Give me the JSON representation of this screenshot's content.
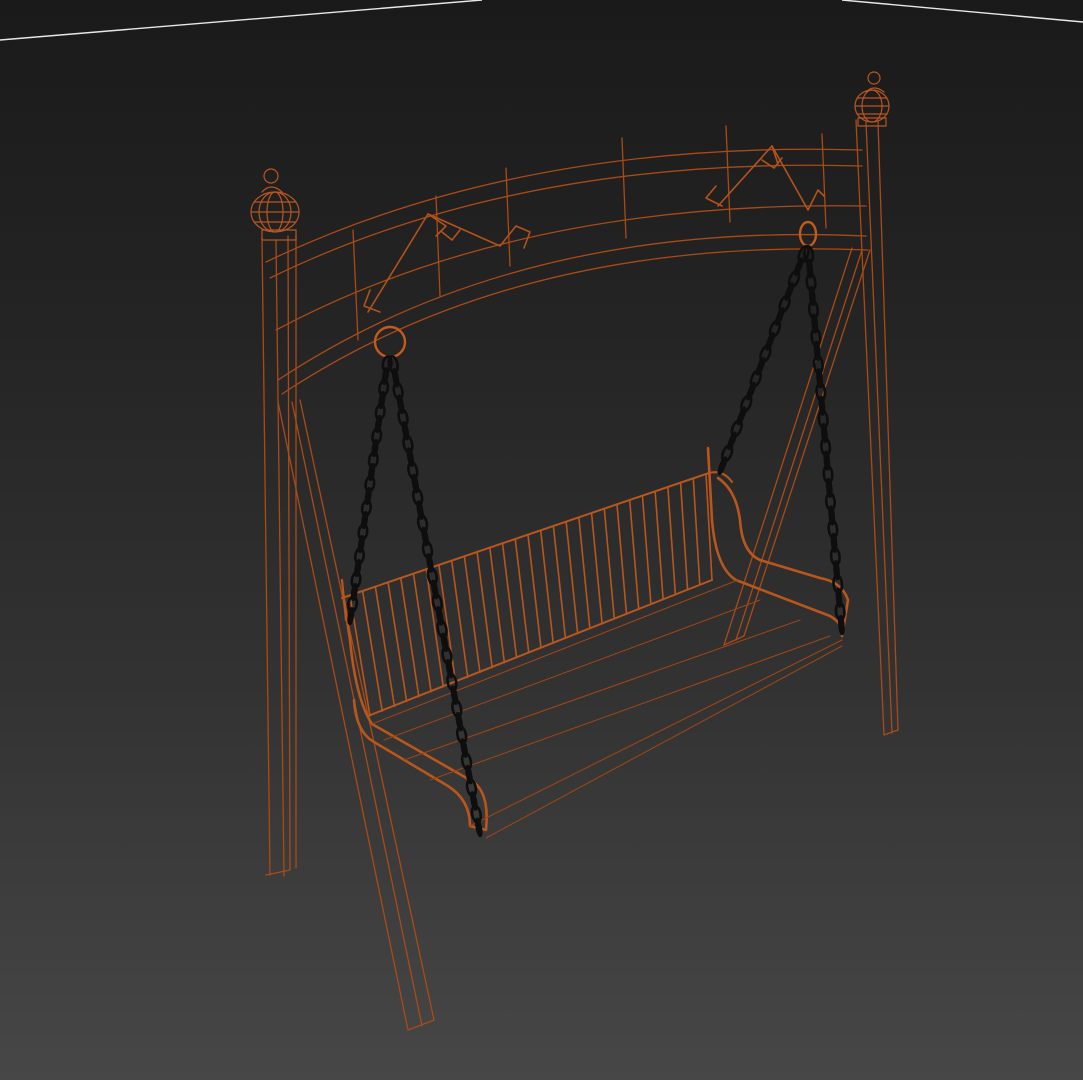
{
  "viewport": {
    "view_mode": "wireframe",
    "background_style": "dark-gradient"
  },
  "model": {
    "object": "porch-swing",
    "wire_color": "#b4501a",
    "wire_color_bright": "#c8621f",
    "chain_color": "#0e0e0e",
    "grid_line_color": "#e6e6e6"
  }
}
